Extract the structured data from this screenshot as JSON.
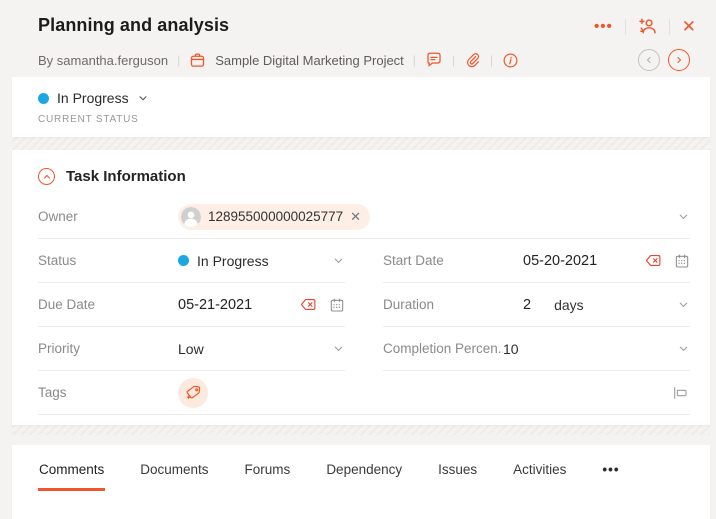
{
  "header": {
    "title": "Planning and analysis",
    "byline": {
      "prefix": "By",
      "author": "samantha.ferguson",
      "project": "Sample Digital Marketing Project"
    },
    "actions": {
      "more": "•••",
      "close": "✕"
    }
  },
  "status_bar": {
    "value": "In Progress",
    "caption": "CURRENT STATUS"
  },
  "task_section": {
    "title": "Task Information"
  },
  "fields": {
    "owner": {
      "label": "Owner",
      "chip": "128955000000025777",
      "remove": "✕"
    },
    "status": {
      "label": "Status",
      "value": "In Progress"
    },
    "start_date": {
      "label": "Start Date",
      "value": "05-20-2021"
    },
    "due_date": {
      "label": "Due Date",
      "value": "05-21-2021"
    },
    "duration": {
      "label": "Duration",
      "value": "2",
      "unit": "days"
    },
    "priority": {
      "label": "Priority",
      "value": "Low"
    },
    "completion": {
      "label": "Completion Percen...",
      "value": "10"
    },
    "tags": {
      "label": "Tags"
    }
  },
  "tabs": [
    {
      "label": "Comments",
      "active": true
    },
    {
      "label": "Documents"
    },
    {
      "label": "Forums"
    },
    {
      "label": "Dependency"
    },
    {
      "label": "Issues"
    },
    {
      "label": "Activities"
    },
    {
      "label": "•••"
    }
  ],
  "colors": {
    "accent": "#f0562b",
    "status_blue": "#1ba8e2"
  }
}
